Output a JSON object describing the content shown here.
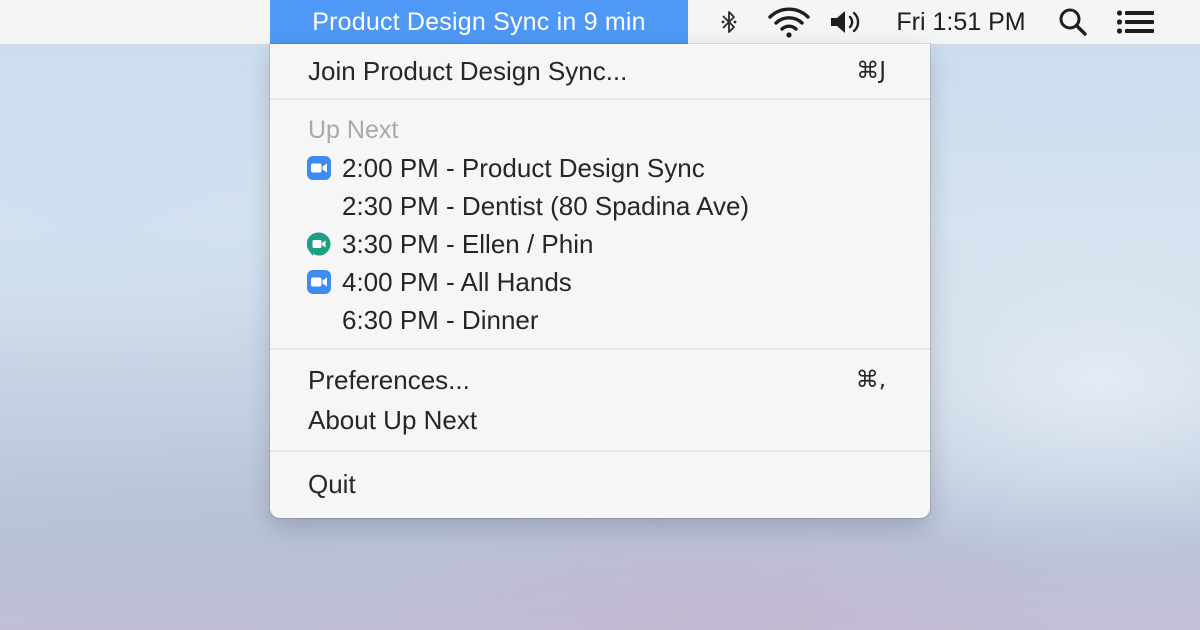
{
  "menubar": {
    "app_status": "Product Design Sync in 9 min",
    "clock": "Fri 1:51 PM",
    "icons": [
      "bluetooth-icon",
      "wifi-icon",
      "volume-icon",
      "spotlight-search-icon",
      "notification-center-icon"
    ]
  },
  "menu": {
    "join_label": "Join Product Design Sync...",
    "join_shortcut": "⌘J",
    "section_title": "Up Next",
    "events": [
      {
        "label": "2:00 PM - Product Design Sync",
        "icon": "zoom-icon"
      },
      {
        "label": "2:30 PM - Dentist (80 Spadina Ave)",
        "icon": ""
      },
      {
        "label": "3:30 PM - Ellen / Phin",
        "icon": "google-meet-icon"
      },
      {
        "label": "4:00 PM - All Hands",
        "icon": "zoom-icon"
      },
      {
        "label": "6:30 PM - Dinner",
        "icon": ""
      }
    ],
    "preferences_label": "Preferences...",
    "preferences_shortcut": "⌘,",
    "about_label": "About Up Next",
    "quit_label": "Quit"
  },
  "colors": {
    "highlight": "#4f98f5",
    "zoom_blue": "#3d8cf5",
    "meet_green": "#1e9e82"
  }
}
